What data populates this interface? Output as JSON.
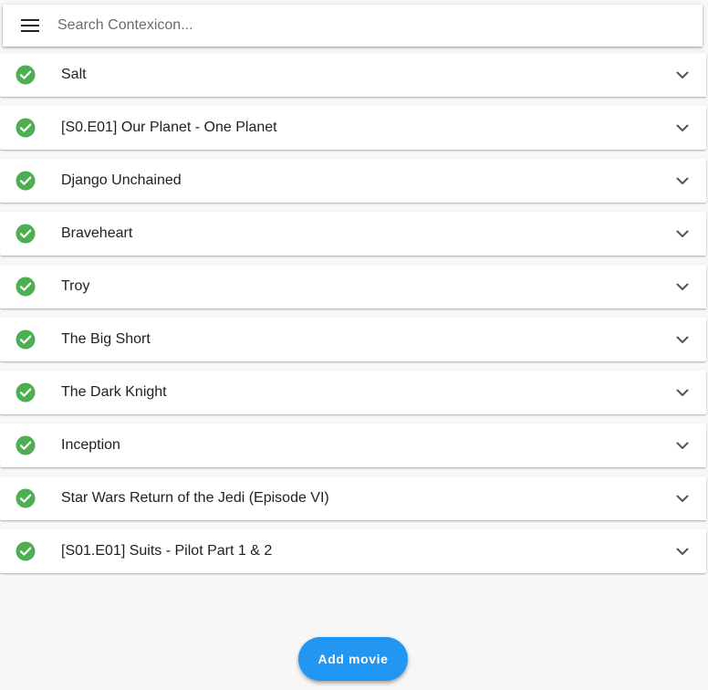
{
  "search": {
    "placeholder": "Search Contexicon...",
    "value": "",
    "menu_icon": "hamburger-menu-icon"
  },
  "status_color": "#4caf50",
  "accent_color": "#2196f3",
  "movies": [
    {
      "title": "Salt",
      "status_icon": "check-circle-icon",
      "expand_icon": "chevron-down-icon"
    },
    {
      "title": "[S0.E01] Our Planet - One Planet",
      "status_icon": "check-circle-icon",
      "expand_icon": "chevron-down-icon"
    },
    {
      "title": "Django Unchained",
      "status_icon": "check-circle-icon",
      "expand_icon": "chevron-down-icon"
    },
    {
      "title": "Braveheart",
      "status_icon": "check-circle-icon",
      "expand_icon": "chevron-down-icon"
    },
    {
      "title": "Troy",
      "status_icon": "check-circle-icon",
      "expand_icon": "chevron-down-icon"
    },
    {
      "title": "The Big Short",
      "status_icon": "check-circle-icon",
      "expand_icon": "chevron-down-icon"
    },
    {
      "title": "The Dark Knight",
      "status_icon": "check-circle-icon",
      "expand_icon": "chevron-down-icon"
    },
    {
      "title": "Inception",
      "status_icon": "check-circle-icon",
      "expand_icon": "chevron-down-icon"
    },
    {
      "title": "Star Wars Return of the Jedi (Episode VI)",
      "status_icon": "check-circle-icon",
      "expand_icon": "chevron-down-icon"
    },
    {
      "title": "[S01.E01] Suits - Pilot Part 1 & 2",
      "status_icon": "check-circle-icon",
      "expand_icon": "chevron-down-icon"
    }
  ],
  "add_button": {
    "label": "Add movie"
  }
}
